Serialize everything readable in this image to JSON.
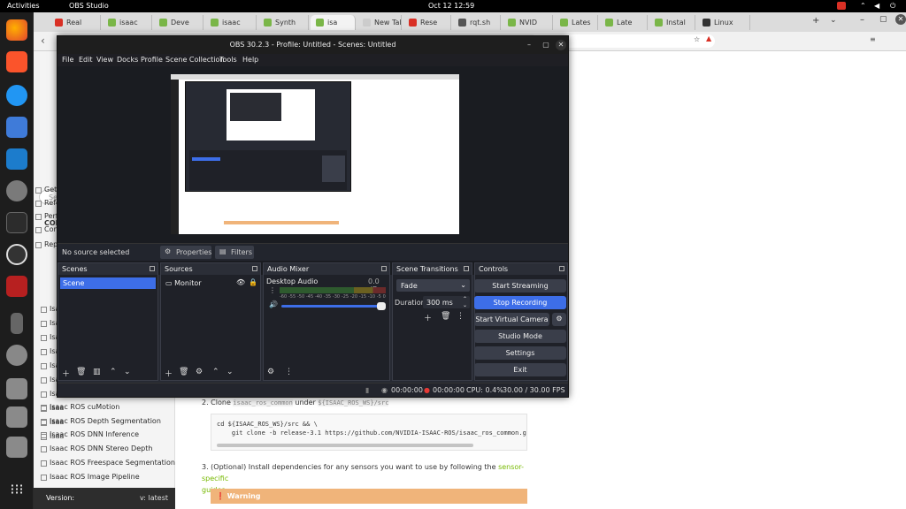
{
  "topbar": {
    "activities": "Activities",
    "app": "OBS Studio",
    "clock": "Oct 12  12:59"
  },
  "tabs": [
    {
      "label": "Real",
      "color": "#d93025"
    },
    {
      "label": "isaac",
      "color": "#7ab648"
    },
    {
      "label": "Deve",
      "color": "#7ab648"
    },
    {
      "label": "isaac",
      "color": "#7ab648"
    },
    {
      "label": "Synth",
      "color": "#7ab648"
    },
    {
      "label": "isa",
      "color": "#7ab648"
    },
    {
      "label": "New Tab",
      "color": "#cccccc"
    },
    {
      "label": "Rese",
      "color": "#d93025"
    },
    {
      "label": "rqt.sh",
      "color": "#555555"
    },
    {
      "label": "NVID",
      "color": "#7ab648"
    },
    {
      "label": "Lates",
      "color": "#7ab648"
    },
    {
      "label": "Late",
      "color": "#7ab648"
    },
    {
      "label": "Instal",
      "color": "#7ab648"
    },
    {
      "label": "Linux",
      "color": "#333333"
    }
  ],
  "address": {
    "fragment": "ckstart"
  },
  "docs": {
    "partial_items": [
      "Gett",
      "Refe",
      "Perf",
      "Con",
      "Rep"
    ],
    "heading": "CON",
    "sub_items_prefix": [
      "Isaa",
      "Isaa",
      "Isaa",
      "Isaa",
      "Isaa",
      "Isaa",
      "Isaa",
      "Isaa",
      "Isaa",
      "Isaa"
    ],
    "nav_items": [
      "Isaac ROS cuMotion",
      "Isaac ROS Depth Segmentation",
      "Isaac ROS DNN Inference",
      "Isaac ROS DNN Stereo Depth",
      "Isaac ROS Freespace Segmentation",
      "Isaac ROS Image Pipeline"
    ],
    "version_label": "Version:",
    "version_value": "v: latest",
    "step2_prefix": "2. Clone ",
    "step2_code": "isaac_ros_common",
    "step2_mid": " under ",
    "step2_path": "${ISAAC_ROS_WS}/src",
    "code_line1": "cd ${ISAAC_ROS_WS}/src && \\",
    "code_line2": "    git clone -b release-3.1 https://github.com/NVIDIA-ISAAC-ROS/isaac_ros_common.git isaac_r",
    "step3_text": "3. (Optional) Install dependencies for any sensors you want to use by following the ",
    "step3_link": "sensor-specific",
    "step3_link2": "guides",
    "warning": "Warning",
    "search_prefix": "Se"
  },
  "obs": {
    "title": "OBS 30.2.3 - Profile: Untitled - Scenes: Untitled",
    "menu": [
      "File",
      "Edit",
      "View",
      "Docks",
      "Profile",
      "Scene Collection",
      "Tools",
      "Help"
    ],
    "no_source": "No source selected",
    "properties": "Properties",
    "filters": "Filters",
    "scenes_title": "Scenes",
    "scene_item": "Scene",
    "sources_title": "Sources",
    "source_item": "Monitor",
    "mixer_title": "Audio Mixer",
    "mixer_channel": "Desktop Audio",
    "mixer_db": "0.0 dB",
    "mixer_ticks": [
      "-60",
      "-55",
      "-50",
      "-45",
      "-40",
      "-35",
      "-30",
      "-25",
      "-20",
      "-15",
      "-10",
      "-5",
      "0"
    ],
    "transitions_title": "Scene Transitions",
    "transition_value": "Fade",
    "duration_label": "Duration",
    "duration_value": "300 ms",
    "controls_title": "Controls",
    "controls": [
      "Start Streaming",
      "Stop Recording",
      "Start Virtual Camera",
      "Studio Mode",
      "Settings",
      "Exit"
    ],
    "status": {
      "stream_time": "00:00:00",
      "rec_time": "00:00:00",
      "cpu": "CPU: 0.4%",
      "fps": "30.00 / 30.00 FPS"
    }
  },
  "colors": {
    "accent": "#3d6ee8",
    "rec": "#e53935",
    "nvidia": "#76b900",
    "warning": "#f0b47a"
  }
}
